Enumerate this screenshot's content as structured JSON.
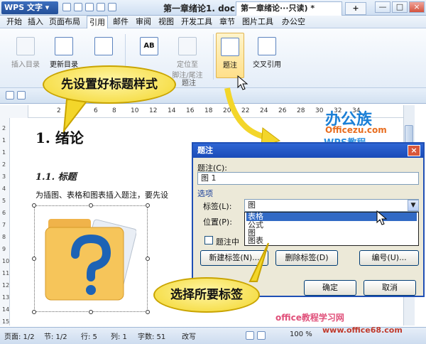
{
  "app": {
    "name": "WPS 文字",
    "doc_title": "第一章绪论1. doc (只读) *"
  },
  "window_buttons": [
    "—",
    "□",
    "×"
  ],
  "menu": [
    "开始",
    "插入",
    "页面布局",
    "引用",
    "邮件",
    "审阅",
    "视图",
    "开发工具",
    "章节",
    "图片工具",
    "办公空"
  ],
  "active_menu": "引用",
  "ribbon": {
    "buttons": [
      {
        "label": "插入目录"
      },
      {
        "label": "更新目录"
      },
      {
        "label": ""
      },
      {
        "label": "AB"
      },
      {
        "label": "定位至",
        "label2": "脚注/尾注"
      },
      {
        "label": "题注"
      },
      {
        "label": "交叉引用"
      }
    ],
    "group_label_1": "题注"
  },
  "doc_tab": {
    "label": "第一章绪论···只读) *",
    "plus": "+"
  },
  "ruler": [
    "2",
    "4",
    "6",
    "8",
    "10",
    "12",
    "14",
    "16",
    "18",
    "20",
    "22",
    "24",
    "26",
    "28",
    "30",
    "32",
    "34"
  ],
  "vruler": [
    "2",
    "1",
    "1",
    "2",
    "3",
    "4",
    "5",
    "6",
    "7",
    "8",
    "9",
    "10",
    "11",
    "12",
    "13",
    "14",
    "15"
  ],
  "document": {
    "h1": "1. 绪论",
    "h2": "1.1.  标题",
    "body": "为插图、表格和图表插入题注，要先设"
  },
  "callouts": {
    "top": "先设置好标题样式",
    "bottom": "选择所要标签"
  },
  "brand": {
    "line1": "办公族",
    "line2": "Officezu.com",
    "line3": "WPS教程"
  },
  "dialog": {
    "title": "题注",
    "caption_label": "题注(C):",
    "caption_value": "图 1",
    "options_label": "选项",
    "tag_label": "标签(L):",
    "tag_value": "图",
    "position_label": "位置(P):",
    "exclude_label": "题注中",
    "dropdown_items": [
      "表格",
      "公式",
      "图",
      "图表"
    ],
    "selected_item": "表格",
    "new_tag": "新建标签(N)...",
    "delete_tag": "删除标签(D)",
    "numbering": "编号(U)...",
    "ok": "确定",
    "cancel": "取消"
  },
  "status": {
    "page": "页面: 1/2",
    "section": "节: 1/2",
    "row": "行: 5",
    "col": "列: 1",
    "words": "字数: 51",
    "revise": "改写",
    "zoom": "100 %"
  },
  "watermark": {
    "line1": "office教程学习网",
    "line2": "www.office68.com"
  },
  "colors": {
    "accent": "#1f4fb5",
    "callout": "#f3d62a",
    "brand_blue": "#1a7fd6",
    "brand_orange": "#e86d1f"
  }
}
